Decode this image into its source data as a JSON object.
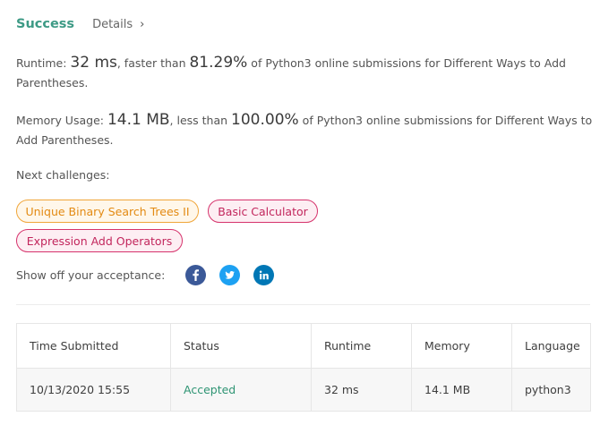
{
  "header": {
    "status_label": "Success",
    "details_label": "Details",
    "details_chevron": "›"
  },
  "runtime": {
    "label": "Runtime:",
    "value": "32 ms",
    "comparison_text": ", faster than",
    "percent": "81.29%",
    "suffix": "of Python3 online submissions for Different Ways to Add Parentheses."
  },
  "memory": {
    "label": "Memory Usage:",
    "value": "14.1 MB",
    "comparison_text": ", less than",
    "percent": "100.00%",
    "suffix": "of Python3 online submissions for Different Ways to Add Parentheses."
  },
  "next_challenges": {
    "label": "Next challenges:",
    "items": [
      {
        "label": "Unique Binary Search Trees II",
        "difficulty": "medium"
      },
      {
        "label": "Basic Calculator",
        "difficulty": "hard"
      },
      {
        "label": "Expression Add Operators",
        "difficulty": "hard"
      }
    ]
  },
  "share": {
    "label": "Show off your acceptance:",
    "icons": [
      {
        "name": "facebook-icon",
        "glyph": "f",
        "color": "#3b5998"
      },
      {
        "name": "twitter-icon",
        "glyph": "",
        "color": "#1da1f2"
      },
      {
        "name": "linkedin-icon",
        "glyph": "in",
        "color": "#0077b5"
      }
    ]
  },
  "table": {
    "headers": [
      "Time Submitted",
      "Status",
      "Runtime",
      "Memory",
      "Language"
    ],
    "rows": [
      [
        "10/13/2020 15:55",
        "Accepted",
        "32 ms",
        "14.1 MB",
        "python3"
      ]
    ]
  },
  "colors": {
    "success": "#3d9a85",
    "medium_tag": "#f0a63a",
    "hard_tag": "#d6336c",
    "accepted": "#2e9473"
  }
}
